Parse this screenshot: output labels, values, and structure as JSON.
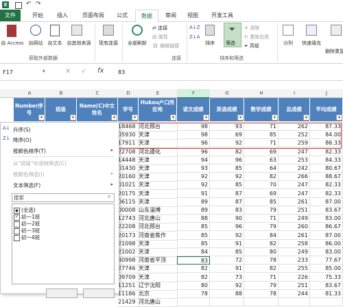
{
  "tabs": [
    "文件",
    "开始",
    "插入",
    "页面布局",
    "公式",
    "数据",
    "审阅",
    "视图",
    "开发工具"
  ],
  "ribbon": {
    "groups": {
      "external": "获取外部数据",
      "connections": "连接",
      "sortfilter": "排序和筛选"
    },
    "buttons": {
      "access": "自 Access",
      "web": "自网站",
      "text": "自文本",
      "other": "自其他来源",
      "existing": "现有连接",
      "refresh": "全部刷新",
      "connections": "连接",
      "properties": "属性",
      "editlinks": "编辑链接",
      "sort": "排序",
      "filter": "筛选",
      "clear": "清除",
      "reapply": "重新应用",
      "advanced": "高级",
      "split": "分列",
      "flashfill": "快速填充",
      "dedupe": "删除重复项"
    }
  },
  "formula": {
    "namebox": "F17",
    "value": "83"
  },
  "columns": [
    "A",
    "B",
    "C",
    "D",
    "E",
    "F",
    "G",
    "H",
    "I",
    "J"
  ],
  "headers": {
    "A": "Number序号",
    "B": "班级",
    "C": "Name(C)中文姓名",
    "D": "学号",
    "E": "Hukou户口所在地",
    "F": "语文成绩",
    "G": "英语成绩",
    "H": "数学成绩",
    "I": "总成绩",
    "J": "平均成绩"
  },
  "rows": [
    {
      "d": "18468",
      "e": "河北邢台",
      "f": "98",
      "g": "93",
      "h": "71",
      "i": "262",
      "j": "87.33"
    },
    {
      "d": "05930",
      "e": "天津",
      "f": "98",
      "g": "69",
      "h": "85",
      "i": "252",
      "j": "84.00"
    },
    {
      "d": "17911",
      "e": "天津",
      "f": "96",
      "g": "92",
      "h": "71",
      "i": "259",
      "j": "86.33"
    },
    {
      "d": "22708",
      "e": "河北遵化",
      "f": "96",
      "g": "82",
      "h": "69",
      "i": "247",
      "j": "82.33"
    },
    {
      "d": "14448",
      "e": "天津",
      "f": "94",
      "g": "96",
      "h": "63",
      "i": "253",
      "j": "84.33"
    },
    {
      "d": "01430",
      "e": "天津",
      "f": "93",
      "g": "85",
      "h": "64",
      "i": "242",
      "j": "80.67"
    },
    {
      "d": "20160",
      "e": "天津",
      "f": "92",
      "g": "92",
      "h": "82",
      "i": "266",
      "j": "88.67"
    },
    {
      "d": "01021",
      "e": "天津",
      "f": "92",
      "g": "85",
      "h": "70",
      "i": "247",
      "j": "82.33"
    },
    {
      "d": "20175",
      "e": "天津",
      "f": "91",
      "g": "87",
      "h": "69",
      "i": "247",
      "j": "82.33"
    },
    {
      "d": "06115",
      "e": "天津",
      "f": "89",
      "g": "87",
      "h": "85",
      "i": "261",
      "j": "87.00"
    },
    {
      "d": "00008",
      "e": "山东淄博",
      "f": "89",
      "g": "83",
      "h": "79",
      "i": "251",
      "j": "83.67"
    },
    {
      "d": "12743",
      "e": "河北唐山",
      "f": "88",
      "g": "90",
      "h": "71",
      "i": "249",
      "j": "83.00"
    },
    {
      "d": "22208",
      "e": "河北邢台",
      "f": "85",
      "g": "96",
      "h": "79",
      "i": "260",
      "j": "86.67"
    },
    {
      "d": "20173",
      "e": "河南省焦作",
      "f": "85",
      "g": "92",
      "h": "84",
      "i": "261",
      "j": "87.00"
    },
    {
      "d": "21098",
      "e": "天津",
      "f": "85",
      "g": "91",
      "h": "82",
      "i": "258",
      "j": "86.00"
    },
    {
      "d": "21002",
      "e": "天津",
      "f": "84",
      "g": "85",
      "h": "80",
      "i": "249",
      "j": "83.00"
    },
    {
      "d": "30998",
      "e": "河南省平顶",
      "f": "83",
      "g": "72",
      "h": "78",
      "i": "233",
      "j": "77.67"
    },
    {
      "d": "27746",
      "e": "天津",
      "f": "82",
      "g": "91",
      "h": "82",
      "i": "255",
      "j": "85.00"
    },
    {
      "d": "09709",
      "e": "天津",
      "f": "82",
      "g": "73",
      "h": "71",
      "i": "226",
      "j": "75.33"
    },
    {
      "d": "11251",
      "e": "辽宁沈阳",
      "f": "80",
      "g": "92",
      "h": "79",
      "i": "251",
      "j": "83.67"
    },
    {
      "d": "11186",
      "e": "北京",
      "f": "78",
      "g": "88",
      "h": "78",
      "i": "244",
      "j": "81.33"
    },
    {
      "d": "21429",
      "e": "河北唐山",
      "f": "",
      "g": "",
      "h": "",
      "i": "",
      "j": ""
    }
  ],
  "menu": {
    "asc": "升序(S)",
    "desc": "降序(O)",
    "bycolor": "按颜色排序(T)",
    "clearfilter": "从\"班级\"中清除筛选(C)",
    "colorfilter": "按颜色筛选(I)",
    "textfilter": "文本筛选(F)",
    "search_placeholder": "搜索",
    "items": [
      {
        "label": "(全选)",
        "state": "partial"
      },
      {
        "label": "初一1班",
        "state": "checked"
      },
      {
        "label": "初一2班",
        "state": "unchecked"
      },
      {
        "label": "初一3班",
        "state": "unchecked"
      },
      {
        "label": "初一4班",
        "state": "unchecked"
      }
    ]
  },
  "colors": {
    "accent": "#217346",
    "header_blue": "#4f81bd",
    "highlight_red": "#c0392b"
  }
}
